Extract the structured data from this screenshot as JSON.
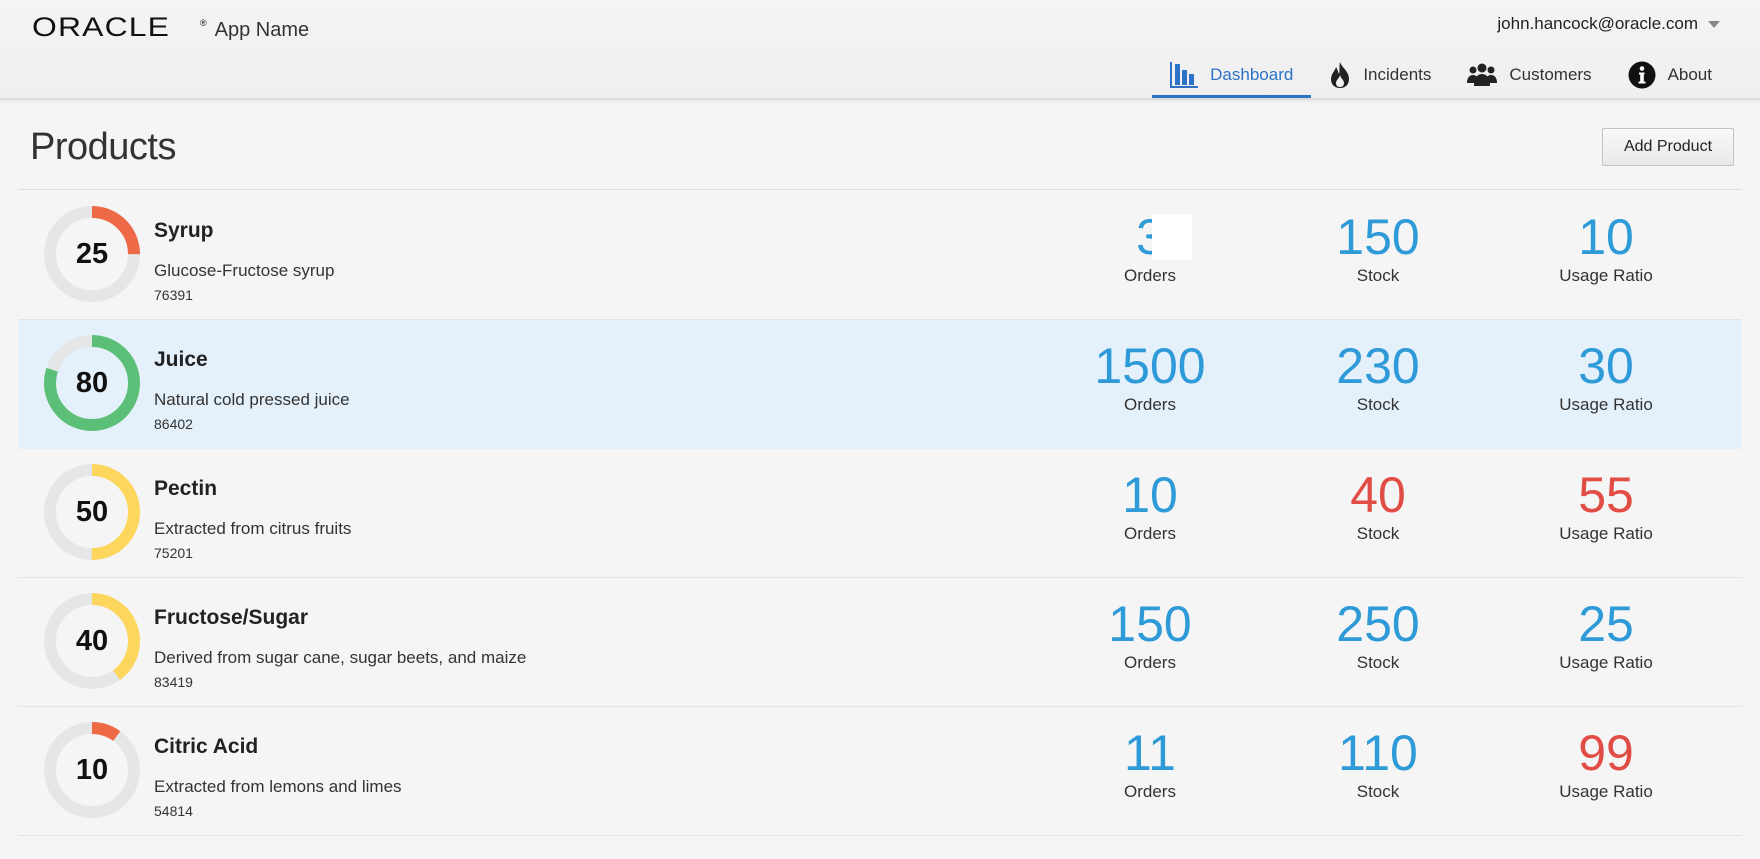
{
  "header": {
    "logo": "ORACLE",
    "logo_mark": "®",
    "app_name": "App Name",
    "user_email": "john.hancock@oracle.com"
  },
  "nav": {
    "items": [
      {
        "label": "Dashboard",
        "icon": "bar-chart-icon",
        "active": true
      },
      {
        "label": "Incidents",
        "icon": "fire-icon",
        "active": false
      },
      {
        "label": "Customers",
        "icon": "people-icon",
        "active": false
      },
      {
        "label": "About",
        "icon": "info-icon",
        "active": false
      }
    ]
  },
  "page": {
    "title": "Products",
    "add_label": "Add Product"
  },
  "colors": {
    "accent": "#2c72c7",
    "value_blue": "#2e9ad8",
    "value_red": "#e14c44",
    "gauge_red": "#ee6a47",
    "gauge_green": "#5cbf78",
    "gauge_yellow": "#fdd65d",
    "gauge_track": "#e4e6e8",
    "selected_row": "#e4f0fa"
  },
  "products": [
    {
      "name": "Syrup",
      "description": "Glucose-Fructose syrup",
      "id": "76391",
      "gauge": 25,
      "gauge_color": "red",
      "orders": "3",
      "stock": "150",
      "usage": "10",
      "orders_alert": false,
      "stock_alert": false,
      "usage_alert": false,
      "orders_label": "Orders",
      "stock_label": "Stock",
      "usage_label": "Usage Ratio",
      "selected": false
    },
    {
      "name": "Juice",
      "description": "Natural cold pressed juice",
      "id": "86402",
      "gauge": 80,
      "gauge_color": "green",
      "orders": "1500",
      "stock": "230",
      "usage": "30",
      "orders_alert": false,
      "stock_alert": false,
      "usage_alert": false,
      "orders_label": "Orders",
      "stock_label": "Stock",
      "usage_label": "Usage Ratio",
      "selected": true
    },
    {
      "name": "Pectin",
      "description": "Extracted from citrus fruits",
      "id": "75201",
      "gauge": 50,
      "gauge_color": "yellow",
      "orders": "10",
      "stock": "40",
      "usage": "55",
      "orders_alert": false,
      "stock_alert": true,
      "usage_alert": true,
      "orders_label": "Orders",
      "stock_label": "Stock",
      "usage_label": "Usage Ratio",
      "selected": false
    },
    {
      "name": "Fructose/Sugar",
      "description": "Derived from sugar cane, sugar beets, and maize",
      "id": "83419",
      "gauge": 40,
      "gauge_color": "yellow",
      "orders": "150",
      "stock": "250",
      "usage": "25",
      "orders_alert": false,
      "stock_alert": false,
      "usage_alert": false,
      "orders_label": "Orders",
      "stock_label": "Stock",
      "usage_label": "Usage Ratio",
      "selected": false
    },
    {
      "name": "Citric Acid",
      "description": "Extracted from lemons and limes",
      "id": "54814",
      "gauge": 10,
      "gauge_color": "red",
      "orders": "11",
      "stock": "110",
      "usage": "99",
      "orders_alert": false,
      "stock_alert": false,
      "usage_alert": true,
      "orders_label": "Orders",
      "stock_label": "Stock",
      "usage_label": "Usage Ratio",
      "selected": false
    }
  ]
}
